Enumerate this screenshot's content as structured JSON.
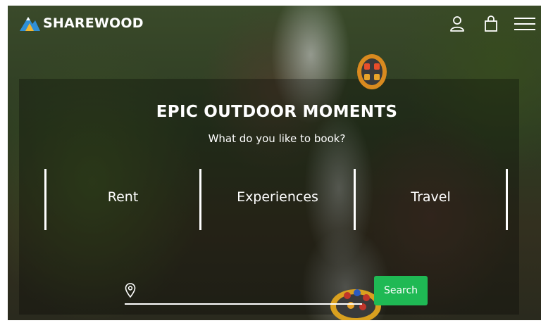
{
  "header": {
    "brand": "SHAREWOOD",
    "icons": [
      "user-icon",
      "shopping-bag-icon",
      "hamburger-menu-icon"
    ]
  },
  "hero": {
    "title": "EPIC OUTDOOR MOMENTS",
    "subtitle": "What do you like to book?",
    "categories": [
      {
        "label": "Rent"
      },
      {
        "label": "Experiences"
      },
      {
        "label": "Travel"
      }
    ]
  },
  "search": {
    "placeholder": "",
    "value": "",
    "button_label": "Search",
    "icon": "location-pin-icon"
  },
  "colors": {
    "accent": "#1fb954",
    "text": "#ffffff",
    "logo_blue": "#2f8fd6",
    "logo_yellow": "#f2b632"
  }
}
